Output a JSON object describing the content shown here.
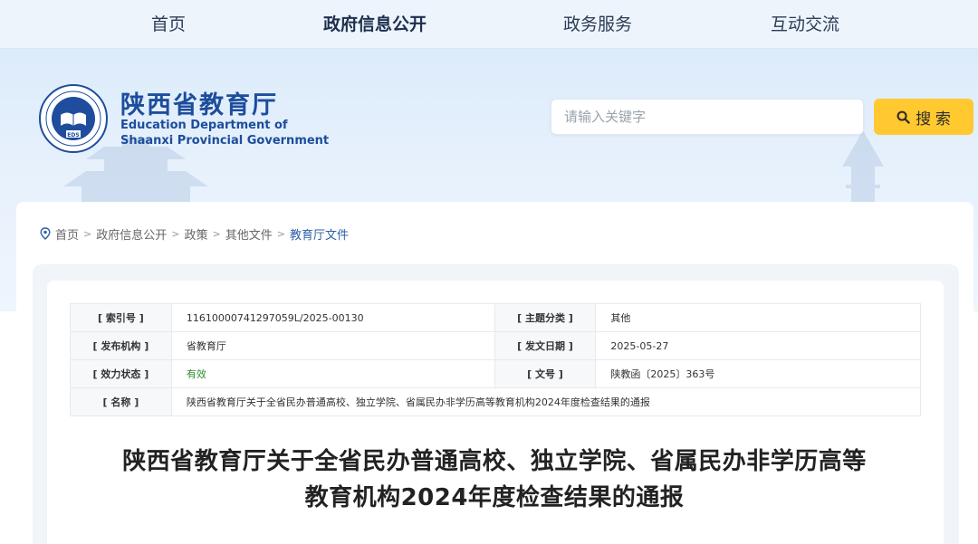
{
  "nav": {
    "items": [
      {
        "label": "首页"
      },
      {
        "label": "政府信息公开"
      },
      {
        "label": "政务服务"
      },
      {
        "label": "互动交流"
      }
    ]
  },
  "header": {
    "logo_cn": "陕西省教育厅",
    "logo_en_line1": "Education Department of",
    "logo_en_line2": "Shaanxi Provincial Government",
    "emblem_text": "EDS"
  },
  "search": {
    "placeholder": "请输入关键字",
    "button_label": "搜 索"
  },
  "breadcrumb": {
    "items": [
      "首页",
      "政府信息公开",
      "政策",
      "其他文件",
      "教育厅文件"
    ],
    "separator": ">"
  },
  "meta": {
    "index_label": "[ 索引号 ]",
    "index_value": "11610000741297059L/2025-00130",
    "topic_label": "[ 主题分类 ]",
    "topic_value": "其他",
    "issuer_label": "[ 发布机构 ]",
    "issuer_value": "省教育厅",
    "date_label": "[ 发文日期 ]",
    "date_value": "2025-05-27",
    "status_label": "[ 效力状态 ]",
    "status_value": "有效",
    "docno_label": "[ 文号 ]",
    "docno_value": "陕教函〔2025〕363号",
    "name_label": "[ 名称 ]",
    "name_value": "陕西省教育厅关于全省民办普通高校、独立学院、省属民办非学历高等教育机构2024年度检查结果的通报"
  },
  "article": {
    "title_line1": "陕西省教育厅关于全省民办普通高校、独立学院、省属民办非学历高等",
    "title_line2": "教育机构2024年度检查结果的通报"
  },
  "colors": {
    "brand_blue": "#1d4d9c",
    "search_button": "#ffc92f",
    "valid_green": "#2d8a2d",
    "breadcrumb_current": "#2a5fa6"
  },
  "icons": {
    "search": "search-icon",
    "location": "location-pin-icon",
    "emblem": "department-emblem-icon"
  }
}
